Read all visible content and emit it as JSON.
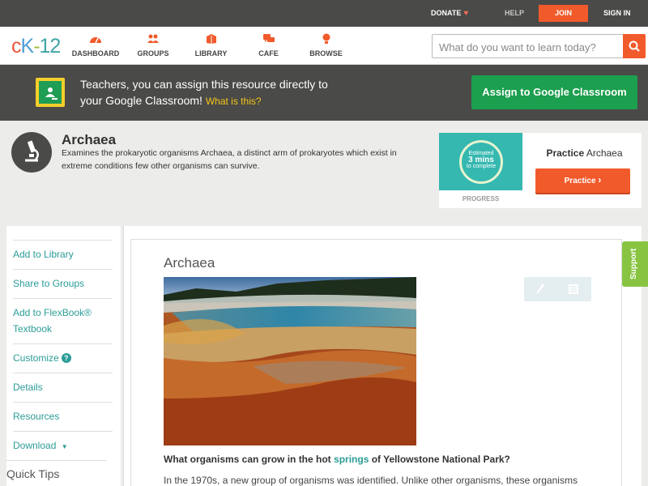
{
  "topbar": {
    "donate": "DONATE",
    "help": "HELP",
    "join": "JOIN",
    "signin": "SIGN IN"
  },
  "nav": {
    "logo": {
      "c": "c",
      "k": "K",
      "dash": "-",
      "n": "12"
    },
    "items": [
      {
        "label": "DASHBOARD",
        "icon": "dashboard-icon"
      },
      {
        "label": "GROUPS",
        "icon": "groups-icon"
      },
      {
        "label": "LIBRARY",
        "icon": "library-icon"
      },
      {
        "label": "CAFE",
        "icon": "cafe-icon"
      },
      {
        "label": "BROWSE",
        "icon": "browse-icon"
      }
    ],
    "search_placeholder": "What do you want to learn today?"
  },
  "banner": {
    "line1": "Teachers, you can assign this resource directly to",
    "line2": "your Google Classroom!",
    "what_link": "What is this?",
    "assign_button": "Assign to Google Classroom"
  },
  "header": {
    "title": "Archaea",
    "description": "Examines the prokaryotic organisms Archaea, a distinct arm of prokaryotes which exist in extreme conditions few other organisms can survive."
  },
  "practice": {
    "estimated_line1": "Estimated",
    "estimated_mins": "3 mins",
    "estimated_line3": "to complete",
    "progress_label": "PROGRESS",
    "title_bold": "Practice",
    "title_rest": "Archaea",
    "button": "Practice"
  },
  "sidebar": {
    "items": [
      {
        "label": "Add to Library"
      },
      {
        "label": "Share to Groups"
      },
      {
        "label": "Add to FlexBook® Textbook"
      },
      {
        "label": "Customize"
      },
      {
        "label": "Details"
      },
      {
        "label": "Resources"
      },
      {
        "label": "Download"
      }
    ],
    "quick_tips": "Quick Tips"
  },
  "content": {
    "title": "Archaea",
    "question_pre": "What organisms can grow in the hot",
    "question_link": "springs",
    "question_post": "of Yellowstone National Park?",
    "paragraph": "In the 1970s, a new group of organisms was identified. Unlike other organisms, these organisms"
  },
  "support": "Support",
  "colors": {
    "brand_orange": "#f15a2b",
    "teal": "#2b9c97",
    "google_green": "#1c9f4e",
    "dark_bar": "#4a4a48"
  }
}
